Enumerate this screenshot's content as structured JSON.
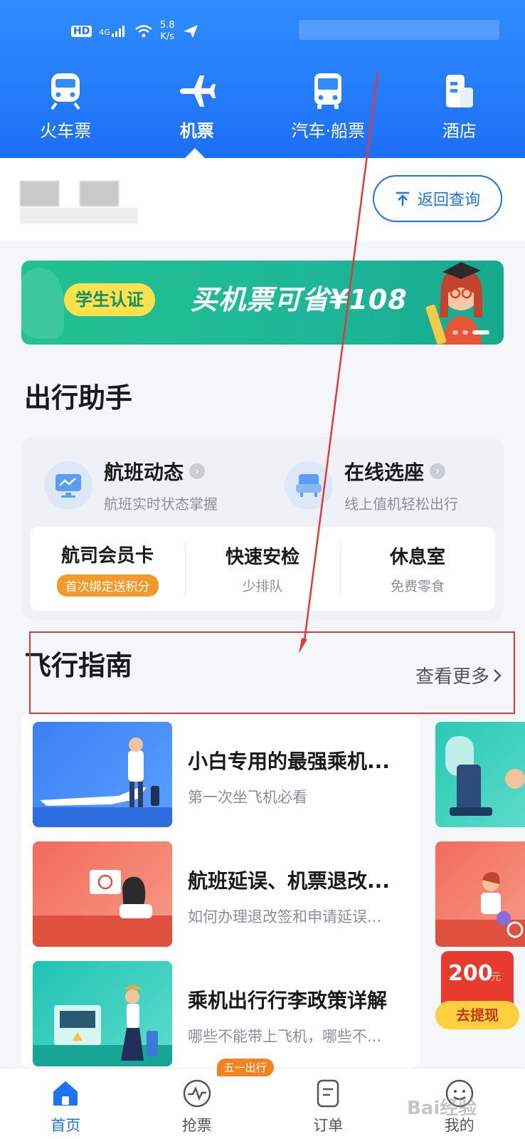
{
  "status_bar": {
    "network_label": "HD",
    "signal_label": "4G",
    "speed_value": "5.8",
    "speed_unit": "K/s"
  },
  "top_tabs": [
    {
      "label": "火车票",
      "icon": "train-icon",
      "active": false
    },
    {
      "label": "机票",
      "icon": "airplane-icon",
      "active": true
    },
    {
      "label": "汽车·船票",
      "icon": "bus-icon",
      "active": false
    },
    {
      "label": "酒店",
      "icon": "hotel-icon",
      "active": false
    }
  ],
  "query": {
    "back_button": "返回查询"
  },
  "banner": {
    "tag": "学生认证",
    "slogan": "买机票可省¥108"
  },
  "assistant": {
    "title": "出行助手",
    "items": [
      {
        "title": "航班动态",
        "subtitle": "航班实时状态掌握",
        "icon": "monitor-icon"
      },
      {
        "title": "在线选座",
        "subtitle": "线上值机轻松出行",
        "icon": "seat-icon"
      }
    ],
    "sub_items": [
      {
        "title": "航司会员卡",
        "badge": "首次绑定送积分"
      },
      {
        "title": "快速安检",
        "subtitle": "少排队"
      },
      {
        "title": "休息室",
        "subtitle": "免费零食"
      }
    ]
  },
  "guide": {
    "title": "飞行指南",
    "more": "查看更多",
    "articles": [
      {
        "title": "小白专用的最强乘机...",
        "subtitle": "第一次坐飞机必看"
      },
      {
        "title": "航班延误、机票退改...",
        "subtitle": "如何办理退改签和申请延误..."
      },
      {
        "title": "乘机出行行李政策详解",
        "subtitle": "哪些不能带上飞机，哪些不..."
      }
    ]
  },
  "promo": {
    "amount": "200",
    "unit": "元",
    "button": "去提现"
  },
  "bottom_nav": [
    {
      "label": "首页",
      "icon": "home-icon",
      "active": true
    },
    {
      "label": "抢票",
      "icon": "pulse-icon",
      "active": false,
      "badge": "五一出行"
    },
    {
      "label": "订单",
      "icon": "order-icon",
      "active": false
    },
    {
      "label": "我的",
      "icon": "profile-icon",
      "active": false
    }
  ],
  "watermark": "Bai经验",
  "colors": {
    "primary": "#1d73f5",
    "header": "#2f8dff",
    "banner": "#22c28e",
    "badge": "#f39a2b",
    "annotation": "#e53935"
  }
}
